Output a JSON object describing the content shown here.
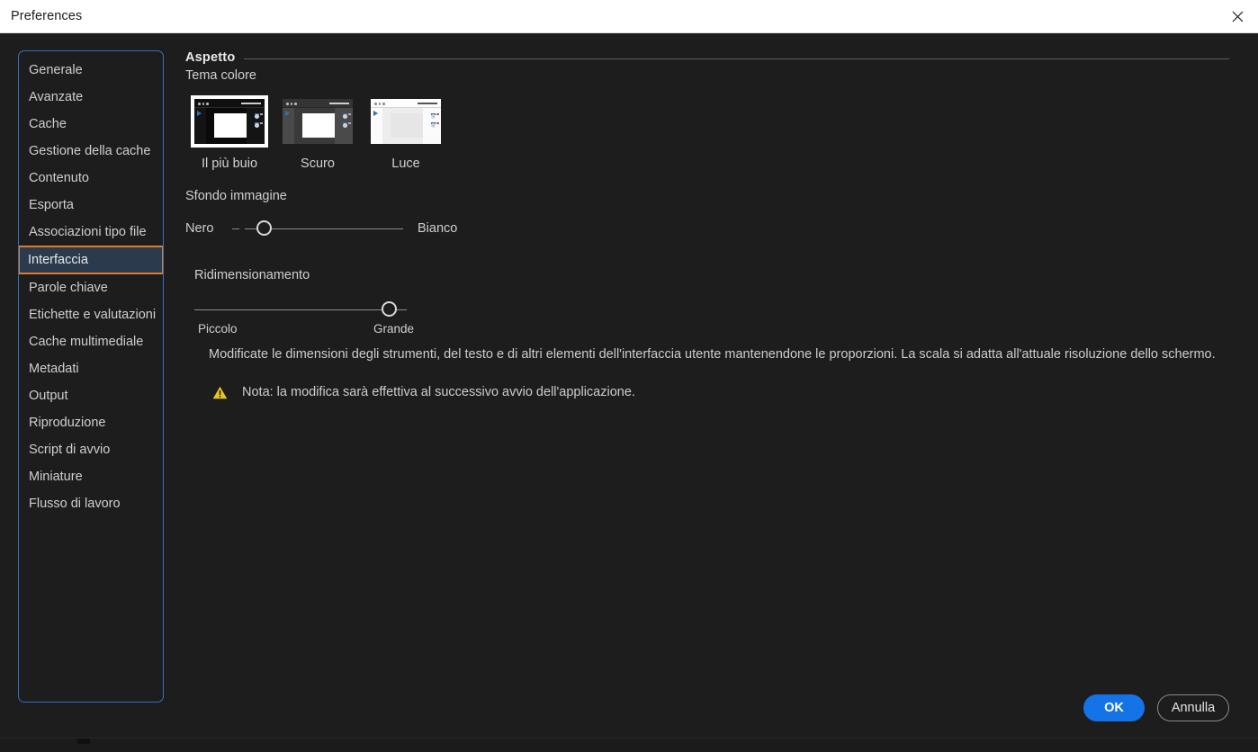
{
  "window": {
    "title": "Preferences",
    "close_icon": "close-icon"
  },
  "sidebar": {
    "items": [
      {
        "label": "Generale",
        "selected": false
      },
      {
        "label": "Avanzate",
        "selected": false
      },
      {
        "label": "Cache",
        "selected": false
      },
      {
        "label": "Gestione della cache",
        "selected": false
      },
      {
        "label": "Contenuto",
        "selected": false
      },
      {
        "label": "Esporta",
        "selected": false
      },
      {
        "label": "Associazioni tipo file",
        "selected": false
      },
      {
        "label": "Interfaccia",
        "selected": true
      },
      {
        "label": "Parole chiave",
        "selected": false
      },
      {
        "label": "Etichette e valutazioni",
        "selected": false
      },
      {
        "label": "Cache multimediale",
        "selected": false
      },
      {
        "label": "Metadati",
        "selected": false
      },
      {
        "label": "Output",
        "selected": false
      },
      {
        "label": "Riproduzione",
        "selected": false
      },
      {
        "label": "Script di avvio",
        "selected": false
      },
      {
        "label": "Miniature",
        "selected": false
      },
      {
        "label": "Flusso di lavoro",
        "selected": false
      }
    ],
    "focus_border_color": "#2f72c4",
    "selected_border_color": "#e07b2a",
    "selected_background_color": "#2b3a4d"
  },
  "content": {
    "section_title": "Aspetto",
    "theme_label": "Tema colore",
    "themes": [
      {
        "label": "Il più buio",
        "selected": true,
        "window_bg": "#0a0a0a",
        "panel_bg": "#141414",
        "topbar_bg": "#101010"
      },
      {
        "label": "Scuro",
        "selected": false,
        "window_bg": "#3a3a3a",
        "panel_bg": "#4a4a4a",
        "topbar_bg": "#343434"
      },
      {
        "label": "Luce",
        "selected": false,
        "window_bg": "#ededed",
        "panel_bg": "#fbfbfb",
        "topbar_bg": "#fdfdfd"
      }
    ],
    "image_background": {
      "label": "Sfondo immagine",
      "min_label": "Nero",
      "max_label": "Bianco",
      "value_percent": 8
    },
    "resize": {
      "label": "Ridimensionamento",
      "min_label": "Piccolo",
      "max_label": "Grande",
      "value_percent": 95
    },
    "description": "Modificate le dimensioni degli strumenti, del testo e di altri elementi dell'interfaccia utente mantenendone le proporzioni. La scala si adatta all'attuale risoluzione dello schermo.",
    "note": {
      "icon": "warning-triangle-icon",
      "icon_color": "#e8c51e",
      "text": "Nota: la modifica sarà effettiva al successivo avvio dell'applicazione."
    }
  },
  "footer": {
    "ok_label": "OK",
    "cancel_label": "Annulla",
    "ok_color": "#1473e6"
  }
}
